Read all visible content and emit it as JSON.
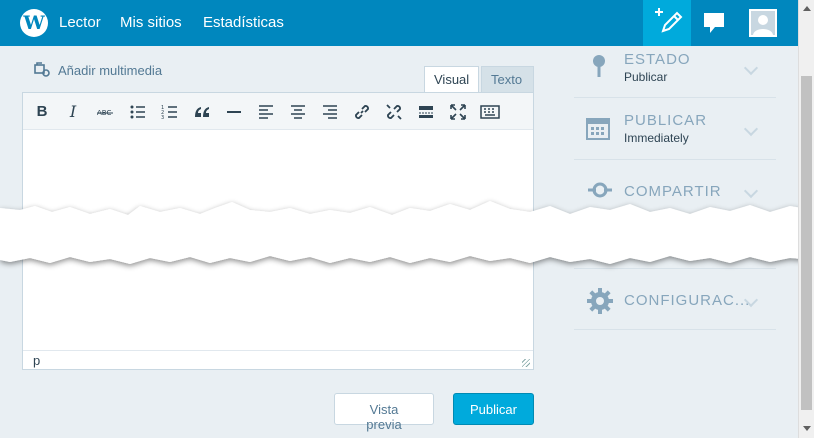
{
  "topbar": {
    "logo": "W",
    "nav": [
      "Lector",
      "Mis sitios",
      "Estadísticas"
    ]
  },
  "editor": {
    "add_media": "Añadir multimedia",
    "tabs": [
      "Visual",
      "Texto"
    ],
    "status_path": "p"
  },
  "buttons": {
    "preview": "Vista previa",
    "publish": "Publicar"
  },
  "panel": {
    "estado_title": "ESTADO",
    "estado_sub": "Publicar",
    "publicar_title": "PUBLICAR",
    "publicar_sub": "Immediately",
    "compartir_title": "COMPARTIR",
    "config_title": "CONFIGURAC..."
  },
  "colors": {
    "brand": "#0087be",
    "accent": "#00aadc",
    "background": "#e9eff3"
  }
}
